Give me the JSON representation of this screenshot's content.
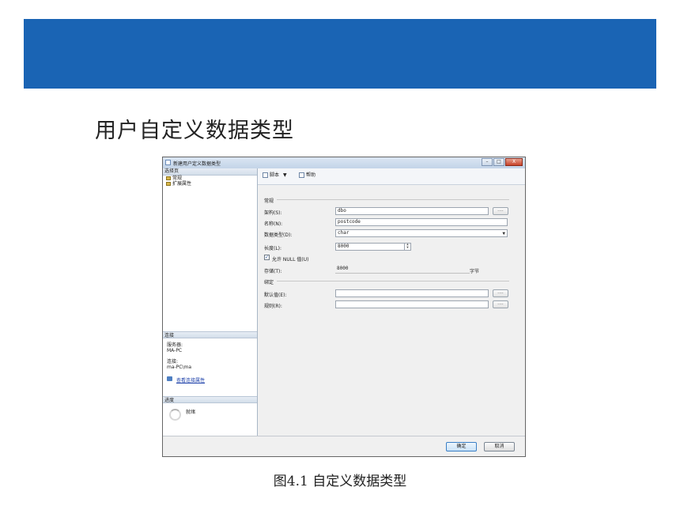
{
  "slide": {
    "title": "用户自定义数据类型",
    "caption": "图4.1  自定义数据类型"
  },
  "window": {
    "title": "新建用户定义数据类型",
    "controls": {
      "minimize": "–",
      "maximize": "□",
      "close": "X"
    }
  },
  "left_pane": {
    "select_page_header": "选择页",
    "pages": [
      "常规",
      "扩展属性"
    ],
    "connection_header": "连接",
    "server_label": "服务器:",
    "server_value": "MA-PC",
    "conn_label": "连接:",
    "conn_value": "ma-PC\\ma",
    "view_link": "查看连接属性",
    "progress_header": "进度",
    "progress_status": "就绪"
  },
  "toolbar": {
    "script_label": "脚本",
    "script_caret": "▼",
    "help_label": "帮助"
  },
  "form": {
    "general_group": "常规",
    "schema_label": "架构(S):",
    "schema_value": "dbo",
    "name_label": "名称(N):",
    "name_value": "postcode",
    "datatype_label": "数据类型(D):",
    "datatype_value": "char",
    "length_label": "长度(L):",
    "length_value": "8000",
    "allow_null_label": "允许 NULL 值(U)",
    "allow_null_checked": true,
    "storage_label": "存储(T):",
    "storage_value": "8000",
    "storage_unit": "字节",
    "binding_group": "绑定",
    "default_label": "默认值(E):",
    "default_value": "",
    "rule_label": "规则(R):",
    "rule_value": "",
    "browse_button": "...."
  },
  "buttons": {
    "ok": "确定",
    "cancel": "取消"
  },
  "colors": {
    "banner": "#1a64b4",
    "link": "#1a3ea8"
  }
}
